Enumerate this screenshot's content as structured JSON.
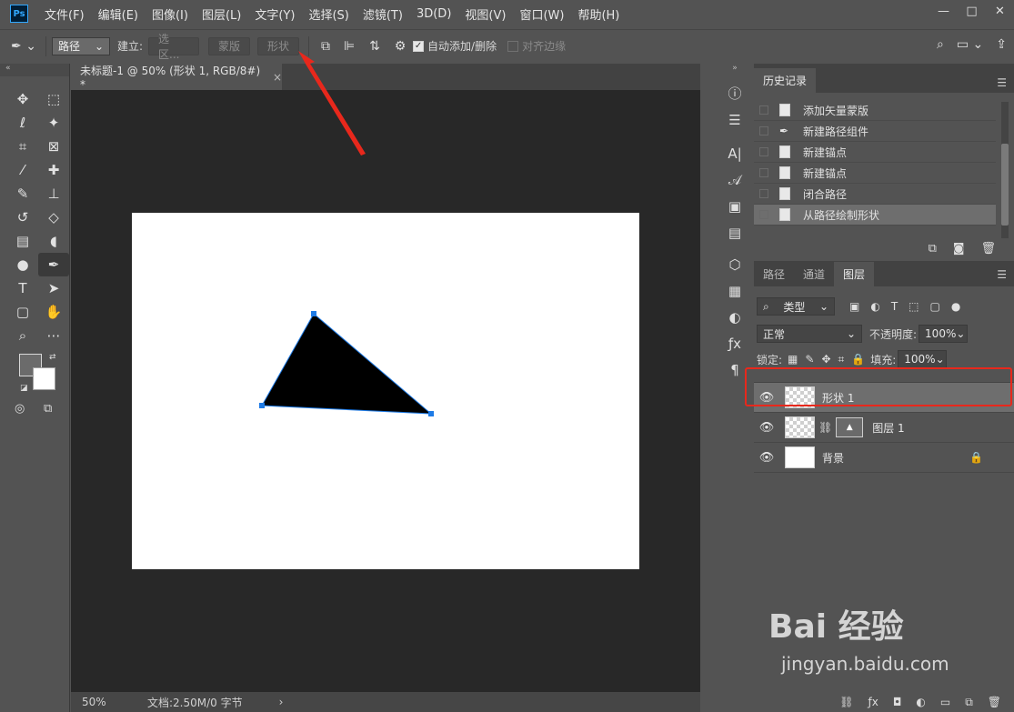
{
  "app": {
    "logo": "Ps",
    "document_tab": "未标题-1 @ 50% (形状 1, RGB/8#) *",
    "tab_close": "×"
  },
  "menu": [
    "文件(F)",
    "编辑(E)",
    "图像(I)",
    "图层(L)",
    "文字(Y)",
    "选择(S)",
    "滤镜(T)",
    "3D(D)",
    "视图(V)",
    "窗口(W)",
    "帮助(H)"
  ],
  "window_controls": {
    "minimize": "—",
    "maximize": "□",
    "close": "✕"
  },
  "options": {
    "mode_value": "路径",
    "make_label": "建立:",
    "selection_btn": "选区...",
    "mask_btn": "蒙版",
    "shape_btn": "形状",
    "auto_add_delete": "自动添加/删除",
    "align_edges": "对齐边缘"
  },
  "status": {
    "zoom": "50%",
    "doc_info": "文档:2.50M/0 字节",
    "arrow": "›"
  },
  "history": {
    "title": "历史记录",
    "items": [
      {
        "label": "添加矢量蒙版",
        "icon": "document-icon"
      },
      {
        "label": "新建路径组件",
        "icon": "pen-icon"
      },
      {
        "label": "新建锚点",
        "icon": "document-icon"
      },
      {
        "label": "新建锚点",
        "icon": "document-icon"
      },
      {
        "label": "闭合路径",
        "icon": "document-icon"
      },
      {
        "label": "从路径绘制形状",
        "icon": "document-icon"
      }
    ]
  },
  "layers_panel": {
    "tabs": [
      "路径",
      "通道",
      "图层"
    ],
    "active_tab": "图层",
    "filter_kind": "类型",
    "blend_mode": "正常",
    "opacity_label": "不透明度:",
    "opacity_value": "100%",
    "lock_label": "锁定:",
    "fill_label": "填充:",
    "fill_value": "100%",
    "layers": [
      {
        "name": "形状 1",
        "selected": true
      },
      {
        "name": "图层 1",
        "selected": false
      },
      {
        "name": "背景",
        "selected": false
      }
    ]
  },
  "canvas": {
    "shape_fill": "#000000",
    "path_color": "#1e7be6"
  },
  "annotation": {
    "arrow_color": "#e8281c",
    "highlight_color": "#e8281c"
  },
  "watermark": {
    "main": "Bai 经验",
    "url": "jingyan.baidu.com"
  }
}
